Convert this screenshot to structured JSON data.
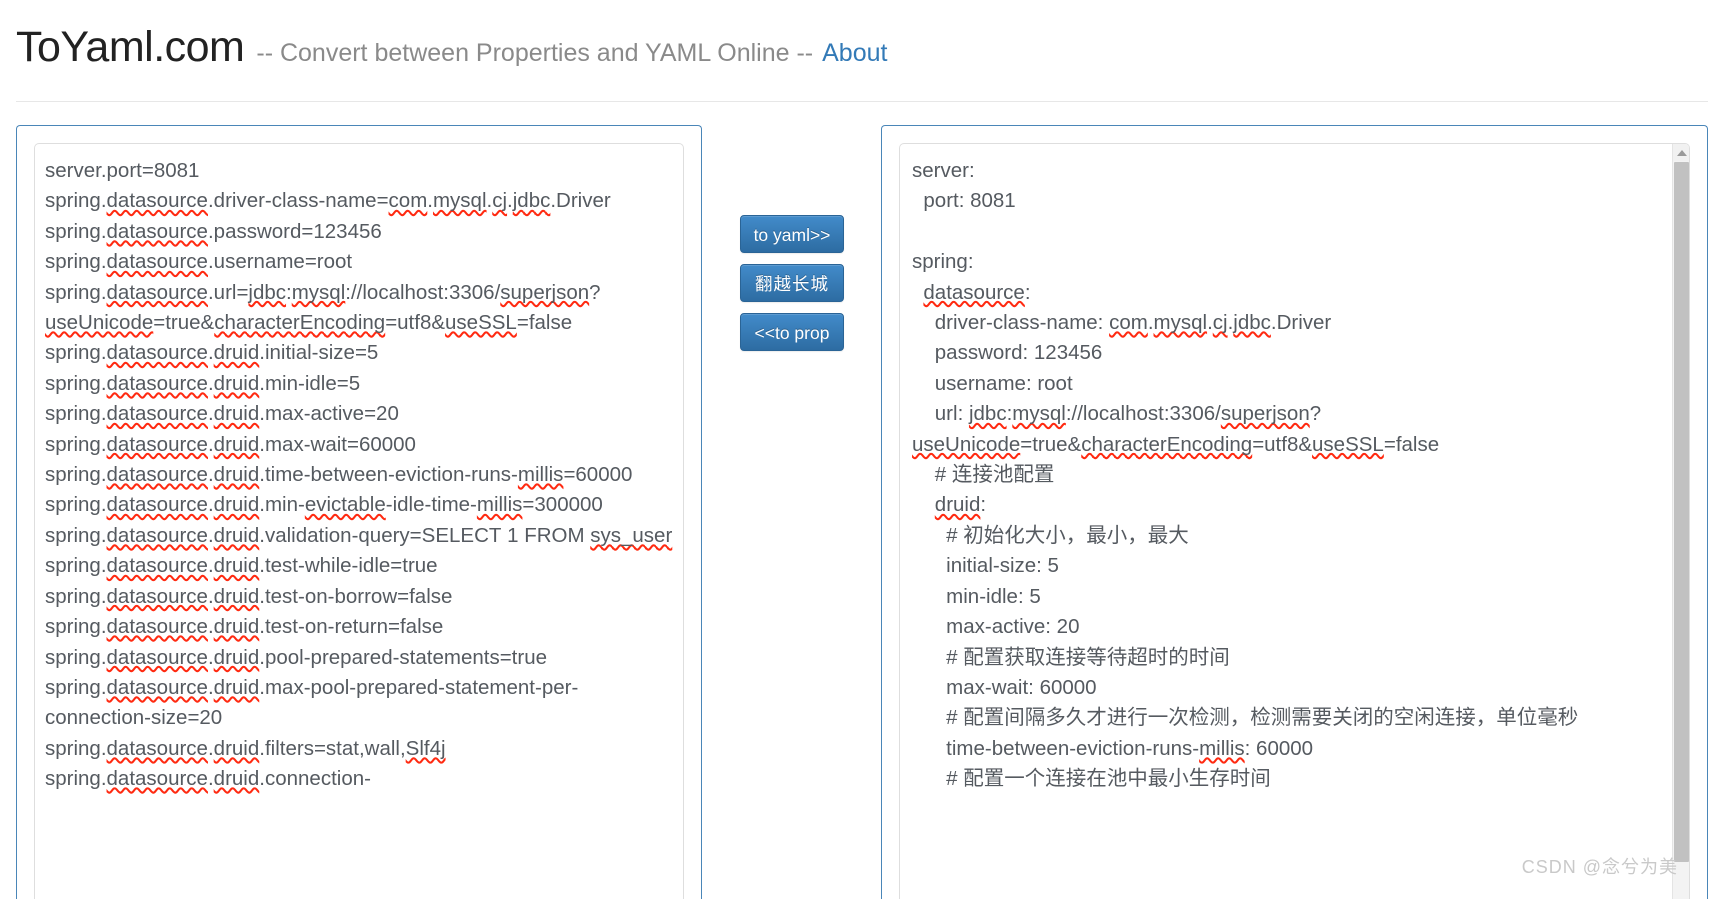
{
  "header": {
    "title": "ToYaml.com",
    "tagline": "-- Convert between Properties and YAML Online --",
    "about_label": "About"
  },
  "buttons": {
    "to_yaml": "to yaml>>",
    "cross_wall": "翻越长城",
    "to_prop": "<<to prop"
  },
  "accent_colors": {
    "button_blue": "#2d6ca2",
    "panel_border": "#4a86b8",
    "link_blue": "#337ab7",
    "spellcheck_red": "#ff2a11",
    "text_gray": "#555a60"
  },
  "left_editor": {
    "name": "properties-input",
    "lines": [
      "server.port=8081",
      "spring.datasource.driver-class-name=com.mysql.cj.jdbc.Driver",
      "spring.datasource.password=123456",
      "spring.datasource.username=root",
      "spring.datasource.url=jdbc:mysql://localhost:3306/superjson?useUnicode=true&characterEncoding=utf8&useSSL=false",
      "spring.datasource.druid.initial-size=5",
      "spring.datasource.druid.min-idle=5",
      "spring.datasource.druid.max-active=20",
      "spring.datasource.druid.max-wait=60000",
      "spring.datasource.druid.time-between-eviction-runs-millis=60000",
      "spring.datasource.druid.min-evictable-idle-time-millis=300000",
      "spring.datasource.druid.validation-query=SELECT 1 FROM sys_user",
      "spring.datasource.druid.test-while-idle=true",
      "spring.datasource.druid.test-on-borrow=false",
      "spring.datasource.druid.test-on-return=false",
      "spring.datasource.druid.pool-prepared-statements=true",
      "spring.datasource.druid.max-pool-prepared-statement-per-connection-size=20",
      "spring.datasource.druid.filters=stat,wall,Slf4j",
      "spring.datasource.druid.connection-"
    ]
  },
  "right_editor": {
    "name": "yaml-output",
    "lines": [
      "server:",
      "  port: 8081",
      "",
      "spring:",
      "  datasource:",
      "    driver-class-name: com.mysql.cj.jdbc.Driver",
      "    password: 123456",
      "    username: root",
      "    url: jdbc:mysql://localhost:3306/superjson?useUnicode=true&characterEncoding=utf8&useSSL=false",
      "    # 连接池配置",
      "    druid:",
      "      # 初始化大小，最小，最大",
      "      initial-size: 5",
      "      min-idle: 5",
      "      max-active: 20",
      "      # 配置获取连接等待超时的时间",
      "      max-wait: 60000",
      "      # 配置间隔多久才进行一次检测，检测需要关闭的空闲连接，单位毫秒",
      "      time-between-eviction-runs-millis: 60000",
      "      # 配置一个连接在池中最小生存时间"
    ]
  },
  "scrollbar": {
    "up_arrow_icon": "triangle-up-icon"
  },
  "watermark": {
    "text": "CSDN @念兮为美"
  }
}
